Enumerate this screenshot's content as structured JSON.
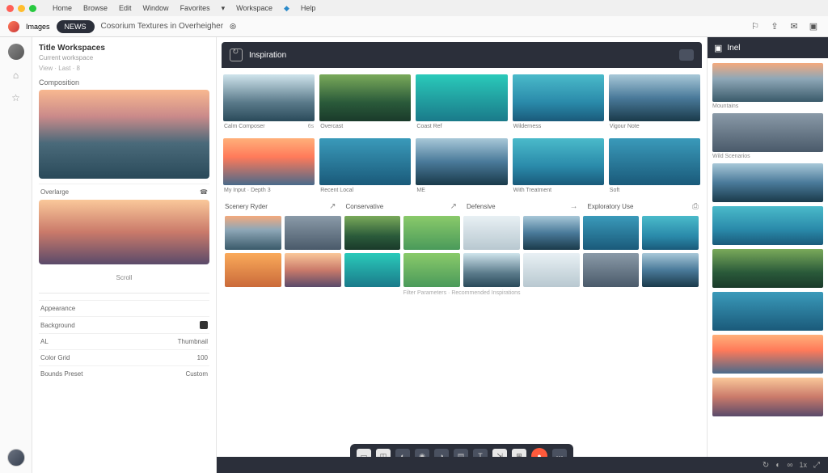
{
  "menubar": {
    "items": [
      "Home",
      "Browse",
      "Edit",
      "Window",
      "Favorites",
      "Workspace",
      "Help"
    ]
  },
  "toolbar": {
    "brand": "Images",
    "pill": "NEWS",
    "title": "Cosorium Textures in Overheigher",
    "status": "◎"
  },
  "sidebar": {
    "header": "Title Workspaces",
    "sub": "Current workspace",
    "meta": "View · Last · 8",
    "preview_label": "Composition",
    "section2_label": "Overlarge",
    "center_label": "Scroll",
    "props": {
      "p1": {
        "label": "Appearance",
        "value": ""
      },
      "p2": {
        "label": "Background",
        "value": ""
      },
      "p3": {
        "label": "Thumbnail",
        "value": "AL"
      },
      "p4": {
        "label": "Color Grid",
        "value": "100"
      },
      "p5": {
        "label": "Bounds Preset",
        "value": "Custom"
      }
    }
  },
  "panel": {
    "title": "Inspiration"
  },
  "grid_row1": [
    {
      "label": "Calm Composer",
      "badge": "6s"
    },
    {
      "label": "Overcast",
      "badge": ""
    },
    {
      "label": "Coast Ref",
      "badge": ""
    },
    {
      "label": "Wilderness",
      "badge": ""
    },
    {
      "label": "Vigour Note",
      "badge": ""
    }
  ],
  "grid_row2": [
    {
      "label": "My Input · Depth 3",
      "badge": ""
    },
    {
      "label": "Recent Local",
      "badge": ""
    },
    {
      "label": "ME",
      "badge": ""
    },
    {
      "label": "With Treatment",
      "badge": ""
    },
    {
      "label": "Soft",
      "badge": ""
    }
  ],
  "sections": [
    {
      "label": "Scenery Ryder",
      "icon": "↗"
    },
    {
      "label": "Conservative",
      "icon": "↗"
    },
    {
      "label": "Defensive",
      "icon": "→"
    },
    {
      "label": "Exploratory Use",
      "icon": "⎙"
    }
  ],
  "bottom_caption": "Filter Parameters · Recommended Inspirations",
  "right": {
    "title": "Inel",
    "items": [
      {
        "label": "Mountains"
      },
      {
        "label": "Wild Scenarios"
      },
      {
        "label": ""
      },
      {
        "label": ""
      },
      {
        "label": ""
      },
      {
        "label": ""
      },
      {
        "label": ""
      }
    ]
  },
  "statusbar": {
    "zoom": "1x"
  }
}
